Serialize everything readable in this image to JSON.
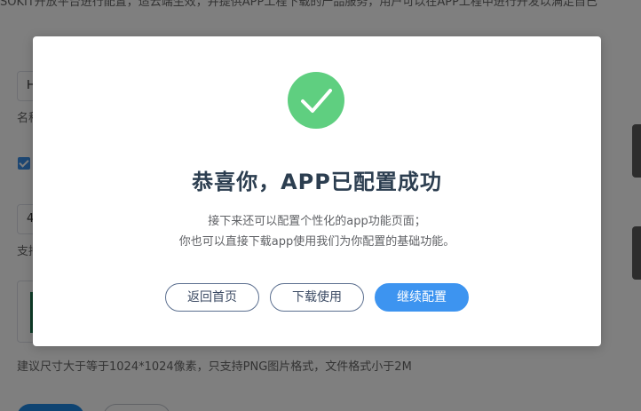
{
  "background": {
    "top_text": "SOKIT开放平台进行配置，适云端生效，并提供APP工程下载的产品服务，用户可以在APP工程中进行开发以满足自己",
    "name_input_value": "H",
    "name_label": "名称",
    "select_value": "4",
    "support_label": "支持",
    "upload_hint": "建议尺寸大于等于1024*1024像素，只支持PNG图片格式，文件格式小于2M"
  },
  "modal": {
    "icon": "check-circle-icon",
    "icon_color": "#5fcf80",
    "title": "恭喜你，APP已配置成功",
    "desc_line1": "接下来还可以配置个性化的app功能页面；",
    "desc_line2": "你也可以直接下载app使用我们为你配置的基础功能。",
    "buttons": {
      "home": "返回首页",
      "download": "下载使用",
      "continue": "继续配置"
    },
    "primary_color": "#3d94f0"
  }
}
